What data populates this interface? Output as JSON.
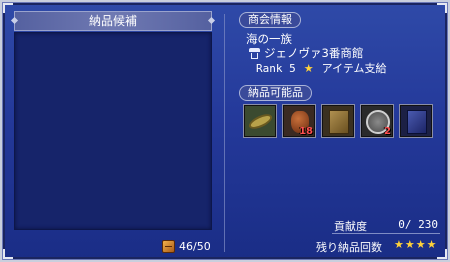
{
  "left_panel": {
    "title": "納品候補",
    "capacity_text": "46/50",
    "capacity_icon": "crate-icon"
  },
  "info": {
    "section_title": "商会情報",
    "clan_name": "海の一族",
    "shop_name": "ジェノヴァ3番商館",
    "shop_icon": "shop-icon",
    "rank_text": "Rank 5",
    "branch_text": "アイテム支給",
    "branch_icon": "star-icon"
  },
  "goods": {
    "section_title": "納品可能品",
    "items": [
      {
        "icon": "lacquer-plate-icon",
        "count": ""
      },
      {
        "icon": "jar-icon",
        "count": "18"
      },
      {
        "icon": "book-icon",
        "count": ""
      },
      {
        "icon": "shield-icon",
        "count": "2"
      },
      {
        "icon": "blue-book-icon",
        "count": ""
      }
    ]
  },
  "contribution": {
    "label": "貢献度",
    "value": "0/ 230"
  },
  "remaining": {
    "label": "残り納品回数",
    "stars": "★★★★"
  }
}
